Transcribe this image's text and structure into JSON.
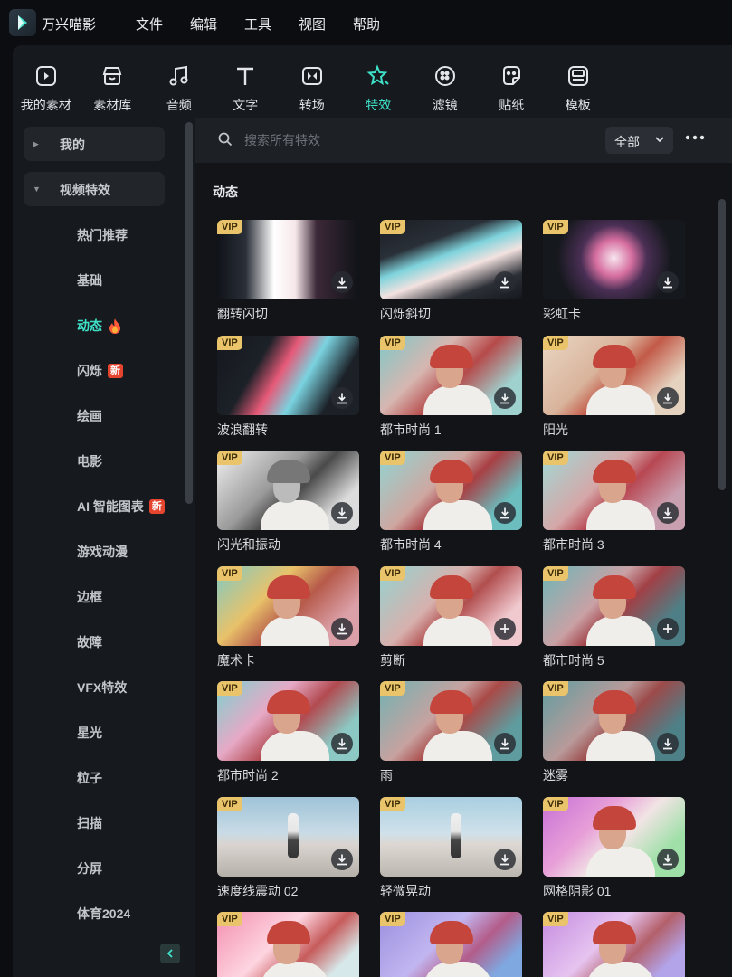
{
  "app": {
    "name": "万兴喵影",
    "menu": [
      "文件",
      "编辑",
      "工具",
      "视图",
      "帮助"
    ]
  },
  "tabs": [
    {
      "label": "我的素材",
      "icon": "my-media-icon",
      "active": false
    },
    {
      "label": "素材库",
      "icon": "stock-library-icon",
      "active": false
    },
    {
      "label": "音频",
      "icon": "music-note-icon",
      "active": false
    },
    {
      "label": "文字",
      "icon": "text-t-icon",
      "active": false
    },
    {
      "label": "转场",
      "icon": "transition-icon",
      "active": false
    },
    {
      "label": "特效",
      "icon": "effects-star-icon",
      "active": true
    },
    {
      "label": "滤镜",
      "icon": "filter-icon",
      "active": false
    },
    {
      "label": "贴纸",
      "icon": "sticker-icon",
      "active": false
    },
    {
      "label": "模板",
      "icon": "template-icon",
      "active": false
    }
  ],
  "sidebar": {
    "groups": [
      {
        "label": "我的",
        "expanded": false
      },
      {
        "label": "视频特效",
        "expanded": true
      }
    ],
    "items": [
      {
        "label": "热门推荐",
        "badge": ""
      },
      {
        "label": "基础",
        "badge": ""
      },
      {
        "label": "动态",
        "badge": "",
        "active": true,
        "icon": "fire-icon"
      },
      {
        "label": "闪烁",
        "badge": "新"
      },
      {
        "label": "绘画",
        "badge": ""
      },
      {
        "label": "电影",
        "badge": ""
      },
      {
        "label": "AI 智能图表",
        "badge": "新"
      },
      {
        "label": "游戏动漫",
        "badge": ""
      },
      {
        "label": "边框",
        "badge": ""
      },
      {
        "label": "故障",
        "badge": ""
      },
      {
        "label": "VFX特效",
        "badge": ""
      },
      {
        "label": "星光",
        "badge": ""
      },
      {
        "label": "粒子",
        "badge": ""
      },
      {
        "label": "扫描",
        "badge": ""
      },
      {
        "label": "分屏",
        "badge": ""
      },
      {
        "label": "体育2024",
        "badge": ""
      }
    ]
  },
  "search": {
    "placeholder": "搜索所有特效",
    "filter_value": "全部"
  },
  "section_title": "动态",
  "vip_label": "VIP",
  "colors": {
    "accent": "#3fe0c8",
    "vip": "#e9c46a",
    "new_badge": "#e5452f"
  },
  "effects": [
    {
      "name": "翻转闪切",
      "vip": true,
      "action": "download"
    },
    {
      "name": "闪烁斜切",
      "vip": true,
      "action": "download"
    },
    {
      "name": "彩虹卡",
      "vip": true,
      "action": "download"
    },
    {
      "name": "波浪翻转",
      "vip": true,
      "action": "download"
    },
    {
      "name": "都市时尚 1",
      "vip": true,
      "action": "download"
    },
    {
      "name": "阳光",
      "vip": true,
      "action": "download"
    },
    {
      "name": "闪光和振动",
      "vip": true,
      "action": "download"
    },
    {
      "name": "都市时尚 4",
      "vip": true,
      "action": "download"
    },
    {
      "name": "都市时尚 3",
      "vip": true,
      "action": "download"
    },
    {
      "name": "魔术卡",
      "vip": true,
      "action": "download"
    },
    {
      "name": "剪断",
      "vip": true,
      "action": "add"
    },
    {
      "name": "都市时尚 5",
      "vip": true,
      "action": "add"
    },
    {
      "name": "都市时尚 2",
      "vip": true,
      "action": "download"
    },
    {
      "name": "雨",
      "vip": true,
      "action": "download"
    },
    {
      "name": "迷雾",
      "vip": true,
      "action": "download"
    },
    {
      "name": "速度线震动 02",
      "vip": true,
      "action": "download"
    },
    {
      "name": "轻微晃动",
      "vip": true,
      "action": "download"
    },
    {
      "name": "网格阴影 01",
      "vip": true,
      "action": "download"
    },
    {
      "name": "",
      "vip": true,
      "action": ""
    },
    {
      "name": "",
      "vip": true,
      "action": ""
    },
    {
      "name": "",
      "vip": true,
      "action": ""
    }
  ]
}
